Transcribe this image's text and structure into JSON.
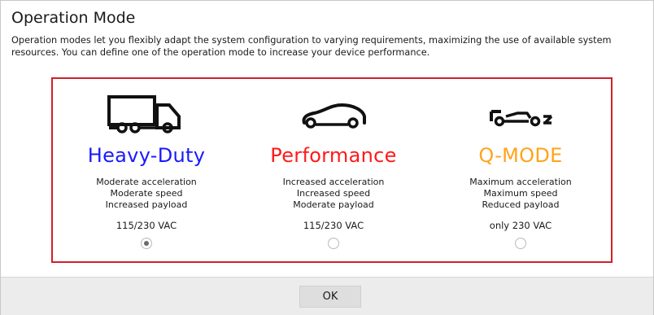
{
  "dialog": {
    "title": "Operation Mode",
    "description": "Operation modes let you flexibly adapt the system configuration to varying requirements, maximizing the use of available system resources. You can define one of the operation mode to increase your device performance."
  },
  "modes": [
    {
      "name": "Heavy-Duty",
      "color": "#1a1aff",
      "icon": "truck-icon",
      "specs": [
        "Moderate acceleration",
        "Moderate speed",
        "Increased payload"
      ],
      "voltage": "115/230 VAC",
      "selected": true
    },
    {
      "name": "Performance",
      "color": "#ff1a1a",
      "icon": "sports-car-icon",
      "specs": [
        "Increased acceleration",
        "Increased speed",
        "Moderate payload"
      ],
      "voltage": "115/230 VAC",
      "selected": false
    },
    {
      "name": "Q-MODE",
      "color": "#ffa31a",
      "icon": "race-car-icon",
      "specs": [
        "Maximum acceleration",
        "Maximum speed",
        "Reduced payload"
      ],
      "voltage": "only 230 VAC",
      "selected": false
    }
  ],
  "footer": {
    "ok_label": "OK"
  },
  "colors": {
    "highlight_border": "#d0202a"
  }
}
